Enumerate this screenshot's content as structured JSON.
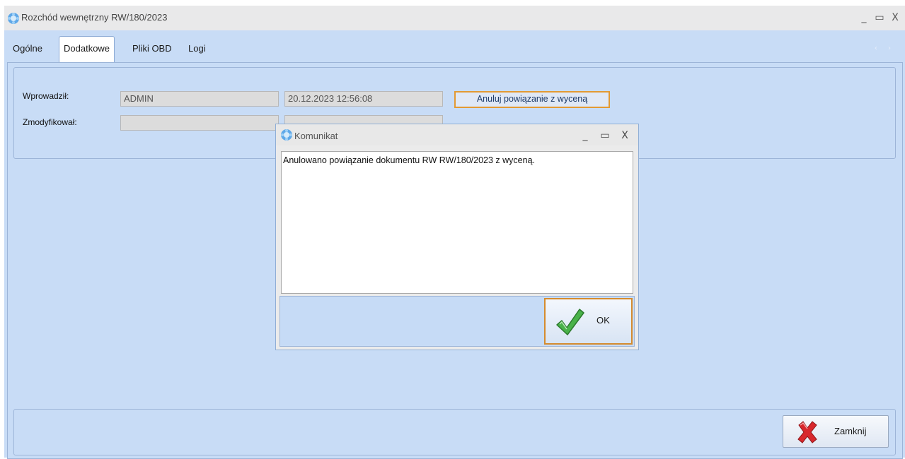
{
  "window": {
    "title": "Rozchód wewnętrzny RW/180/2023",
    "minimize": "_",
    "maximize": "▭",
    "close": "X"
  },
  "tabs": [
    {
      "label": "Ogólne",
      "active": false
    },
    {
      "label": "Dodatkowe",
      "active": true
    },
    {
      "label": "Pliki OBD",
      "active": false
    },
    {
      "label": "Logi",
      "active": false
    }
  ],
  "form": {
    "entered_by_label": "Wprowadził:",
    "entered_by_value": "ADMIN",
    "entered_date_value": "20.12.2023 12:56:08",
    "modified_by_label": "Zmodyfikował:",
    "modified_by_value": "",
    "modified_date_value": "",
    "unlink_button": "Anuluj powiązanie z wyceną"
  },
  "close_button": {
    "label": "Zamknij",
    "icon": "red-x-icon"
  },
  "dialog": {
    "title": "Komunikat",
    "message": "Anulowano powiązanie dokumentu RW RW/180/2023 z wyceną.",
    "ok_label": "OK",
    "ok_icon": "green-check-icon"
  },
  "colors": {
    "panel_bg": "#c8dcf6",
    "focus_border": "#d58b2e",
    "title_bg": "#e9e9ea"
  }
}
